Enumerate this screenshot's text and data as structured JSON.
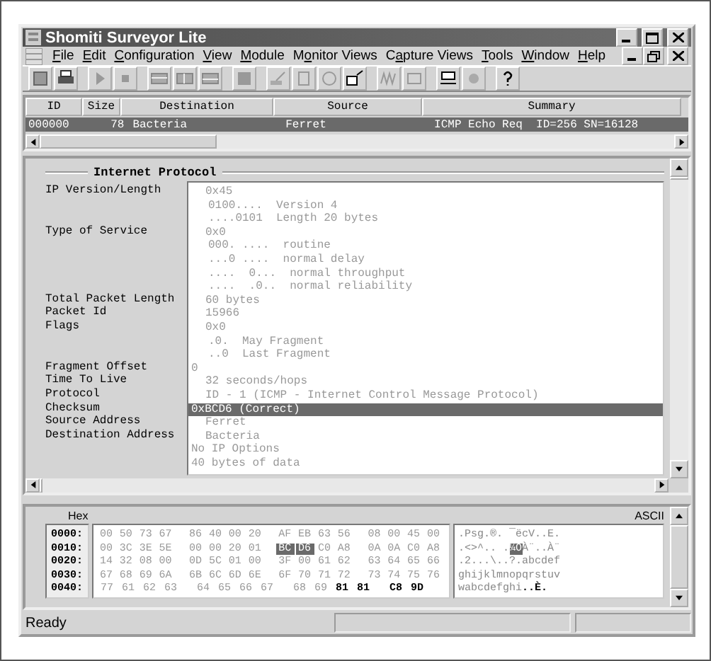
{
  "window": {
    "title": "Shomiti Surveyor Lite"
  },
  "menu": [
    {
      "key": "F",
      "post": "ile"
    },
    {
      "key": "E",
      "post": "dit"
    },
    {
      "key": "C",
      "post": "onfiguration"
    },
    {
      "key": "V",
      "post": "iew"
    },
    {
      "key": "M",
      "post": "odule"
    },
    {
      "pre": "M",
      "key": "o",
      "post": "nitor Views"
    },
    {
      "pre": "C",
      "key": "a",
      "post": "pture Views"
    },
    {
      "key": "T",
      "post": "ools"
    },
    {
      "key": "W",
      "post": "indow"
    },
    {
      "key": "H",
      "post": "elp"
    }
  ],
  "packet_list": {
    "columns": [
      "ID",
      "Size",
      "Destination",
      "Source",
      "Summary"
    ],
    "rows": [
      {
        "id": "000000",
        "size": "78",
        "destination": "Bacteria",
        "source": "Ferret",
        "summary": "ICMP Echo Req  ID=256 SN=16128",
        "selected": true
      }
    ]
  },
  "detail": {
    "title": "Internet Protocol",
    "fields": [
      {
        "label": "IP Version/Length",
        "value": "0x45",
        "indented": true,
        "selected": false,
        "children": [
          "0100....  Version 4",
          "....0101  Length 20 bytes"
        ]
      },
      {
        "label": "Type of Service",
        "value": "0x0",
        "indented": true,
        "selected": false,
        "children": [
          "000. ....  routine",
          "...0 ....  normal delay",
          "....  0...  normal throughput",
          "....  .0..  normal reliability"
        ]
      },
      {
        "label": "Total Packet Length",
        "value": "60 bytes",
        "indented": true,
        "selected": false
      },
      {
        "label": "Packet Id",
        "value": "15966",
        "indented": true,
        "selected": false
      },
      {
        "label": "Flags",
        "value": "0x0",
        "indented": true,
        "selected": false,
        "children": [
          ".0.  May Fragment",
          "..0  Last Fragment"
        ]
      },
      {
        "label": "Fragment Offset",
        "value": "0",
        "indented": false,
        "selected": false
      },
      {
        "label": "Time To Live",
        "value": "32 seconds/hops",
        "indented": true,
        "selected": false
      },
      {
        "label": "Protocol",
        "value": "ID - 1 (ICMP - Internet Control Message Protocol)",
        "indented": true,
        "selected": false
      },
      {
        "label": "Checksum",
        "value": "0xBCD6 (Correct)",
        "indented": false,
        "selected": true
      },
      {
        "label": "Source Address",
        "value": "Ferret",
        "indented": true,
        "selected": false
      },
      {
        "label": "Destination Address",
        "value": "Bacteria",
        "indented": true,
        "selected": false
      },
      {
        "value": "No IP Options",
        "indented": false,
        "selected": false
      },
      {
        "value": "40 bytes of data",
        "indented": false,
        "selected": false
      }
    ]
  },
  "hex": {
    "hex_label": "Hex",
    "ascii_label": "ASCII",
    "rows": [
      {
        "offset": "0000:",
        "bytes": [
          "00",
          "50",
          "73",
          "67",
          "86",
          "40",
          "00",
          "20",
          "AF",
          "EB",
          "63",
          "56",
          "08",
          "00",
          "45",
          "00"
        ],
        "ascii": [
          {
            "text": ".Psg.®. ¯ëcV..E.",
            "kind": "plain"
          }
        ]
      },
      {
        "offset": "0010:",
        "bytes": [
          "00",
          "3C",
          "3E",
          "5E",
          "00",
          "00",
          "20",
          "01",
          {
            "text": "BC",
            "kind": "selected"
          },
          {
            "text": "D6",
            "kind": "selected"
          },
          "C0",
          "A8",
          "0A",
          "0A",
          "C0",
          "A8"
        ],
        "ascii": [
          {
            "text": ".<>^.. .",
            "kind": "plain"
          },
          {
            "text": "¼Ö",
            "kind": "selected"
          },
          {
            "text": "À¨..À¨",
            "kind": "plain"
          }
        ]
      },
      {
        "offset": "0020:",
        "bytes": [
          "14",
          "32",
          "08",
          "00",
          "0D",
          "5C",
          "01",
          "00",
          "3F",
          "00",
          "61",
          "62",
          "63",
          "64",
          "65",
          "66"
        ],
        "ascii": [
          {
            "text": ".2...\\..?.abcdef",
            "kind": "plain"
          }
        ]
      },
      {
        "offset": "0030:",
        "bytes": [
          "67",
          "68",
          "69",
          "6A",
          "6B",
          "6C",
          "6D",
          "6E",
          "6F",
          "70",
          "71",
          "72",
          "73",
          "74",
          "75",
          "76"
        ],
        "ascii": [
          {
            "text": "ghijklmnopqrstuv",
            "kind": "plain"
          }
        ]
      },
      {
        "offset": "0040:",
        "bytes": [
          "77",
          "61",
          "62",
          "63",
          "64",
          "65",
          "66",
          "67",
          "68",
          "69",
          {
            "text": "81",
            "kind": "bold"
          },
          {
            "text": "81",
            "kind": "bold"
          },
          {
            "text": "C8",
            "kind": "bold"
          },
          {
            "text": "9D",
            "kind": "bold"
          }
        ],
        "ascii": [
          {
            "text": "wabcdefghi",
            "kind": "plain"
          },
          {
            "text": "..È.",
            "kind": "bold"
          }
        ]
      }
    ]
  },
  "status_bar": {
    "text": "Ready"
  }
}
